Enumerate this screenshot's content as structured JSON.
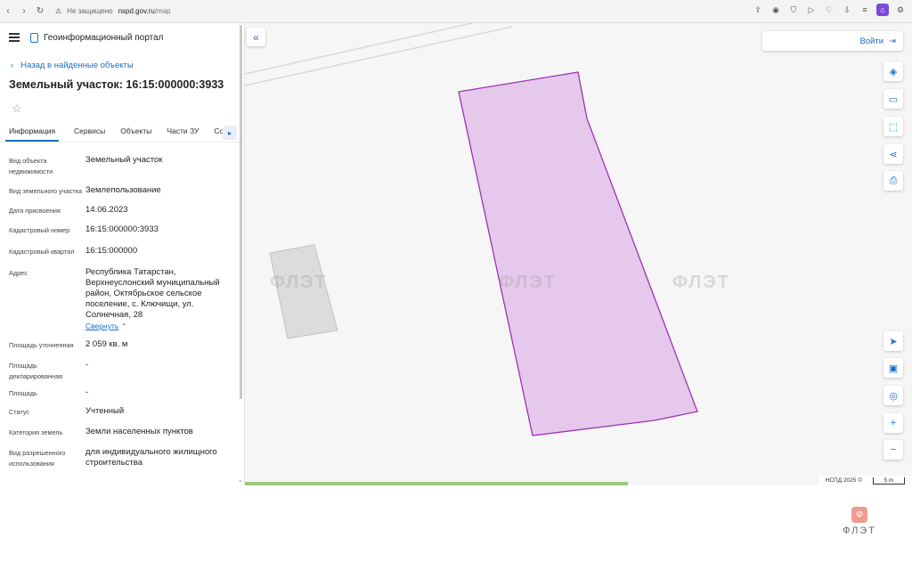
{
  "browser": {
    "insecure_label": "Не защищено",
    "url_host": "nspd.gov.ru",
    "url_path": "/map"
  },
  "portal": {
    "title": "Геоинформационный портал"
  },
  "object": {
    "back_label": "Назад в найденные объекты",
    "title": "Земельный участок: 16:15:000000:3933"
  },
  "tabs": [
    {
      "label": "Информация"
    },
    {
      "label": "Сервисы"
    },
    {
      "label": "Объекты"
    },
    {
      "label": "Части ЗУ"
    },
    {
      "label": "Соста"
    }
  ],
  "properties": [
    {
      "key": "Вид объекта недвижимости",
      "value": "Земельный участок"
    },
    {
      "key": "Вид земельного участка",
      "value": "Землепользование"
    },
    {
      "key": "Дата присвоения",
      "value": "14.06.2023"
    },
    {
      "key": "Кадастровый номер",
      "value": "16:15:000000:3933"
    },
    {
      "key": "Кадастровый квартал",
      "value": "16:15:000000"
    },
    {
      "key": "Адрес",
      "value": "Республика Татарстан, Верхнеуслонский муниципальный район, Октябрьское сельское поселение, с. Ключищи, ул. Солнечная, 28"
    },
    {
      "key": "Площадь уточненная",
      "value": "2 059 кв. м"
    },
    {
      "key": "Площадь декларированная",
      "value": "-"
    },
    {
      "key": "Площадь",
      "value": "-"
    },
    {
      "key": "Статус",
      "value": "Учтенный"
    },
    {
      "key": "Категория земель",
      "value": "Земли населенных пунктов"
    },
    {
      "key": "Вид разрешенного использования",
      "value": "для индивидуального жилищного строительства"
    }
  ],
  "address_collapse": "Свернуть",
  "map": {
    "login_label": "Войти",
    "attribution": "НСПД 2025 ©",
    "scale_label": "5 m",
    "parcel_fill": "#e6c8ec",
    "parcel_stroke": "#9b34b0",
    "watermark": "ФЛЭТ"
  },
  "footer": {
    "brand": "ФЛЭТ",
    "badge": "Ф"
  }
}
